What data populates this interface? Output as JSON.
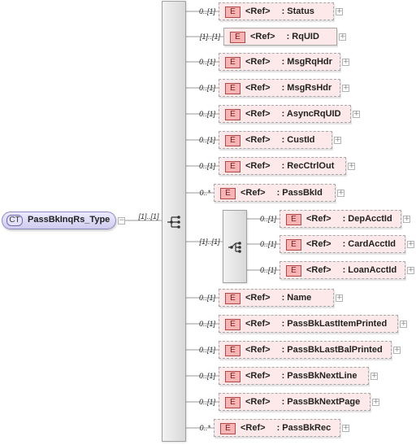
{
  "complex_type": {
    "badge": "CT",
    "name": "PassBkInqRs_Type",
    "cardinality": "[1]..[1]"
  },
  "element_badge": "E",
  "main_sequence": [
    {
      "card": "0..[1]",
      "ref": "<Ref>",
      "name": ": Status",
      "required": false
    },
    {
      "card": "[1]..[1]",
      "ref": "<Ref>",
      "name": ": RqUID",
      "required": true
    },
    {
      "card": "0..[1]",
      "ref": "<Ref>",
      "name": ": MsgRqHdr",
      "required": false
    },
    {
      "card": "0..[1]",
      "ref": "<Ref>",
      "name": ": MsgRsHdr",
      "required": false
    },
    {
      "card": "0..[1]",
      "ref": "<Ref>",
      "name": ": AsyncRqUID",
      "required": false
    },
    {
      "card": "0..[1]",
      "ref": "<Ref>",
      "name": ": CustId",
      "required": false
    },
    {
      "card": "0..[1]",
      "ref": "<Ref>",
      "name": ": RecCtrlOut",
      "required": false
    },
    {
      "card": "0..*",
      "ref": "<Ref>",
      "name": ": PassBkId",
      "required": false
    },
    {
      "card": "0..[1]",
      "ref": "<Ref>",
      "name": ": Name",
      "required": false
    },
    {
      "card": "0..[1]",
      "ref": "<Ref>",
      "name": ": PassBkLastItemPrinted",
      "required": false
    },
    {
      "card": "0..[1]",
      "ref": "<Ref>",
      "name": ": PassBkLastBalPrinted",
      "required": false
    },
    {
      "card": "0..[1]",
      "ref": "<Ref>",
      "name": ": PassBkNextLine",
      "required": false
    },
    {
      "card": "0..[1]",
      "ref": "<Ref>",
      "name": ": PassBkNextPage",
      "required": false
    },
    {
      "card": "0..*",
      "ref": "<Ref>",
      "name": ": PassBkRec",
      "required": false
    }
  ],
  "choice_group": {
    "card": "[1]..[1]",
    "items": [
      {
        "card": "0..[1]",
        "ref": "<Ref>",
        "name": ": DepAcctId",
        "required": false
      },
      {
        "card": "0..[1]",
        "ref": "<Ref>",
        "name": ": CardAcctId",
        "required": false
      },
      {
        "card": "0..[1]",
        "ref": "<Ref>",
        "name": ": LoanAcctId",
        "required": false
      }
    ]
  }
}
